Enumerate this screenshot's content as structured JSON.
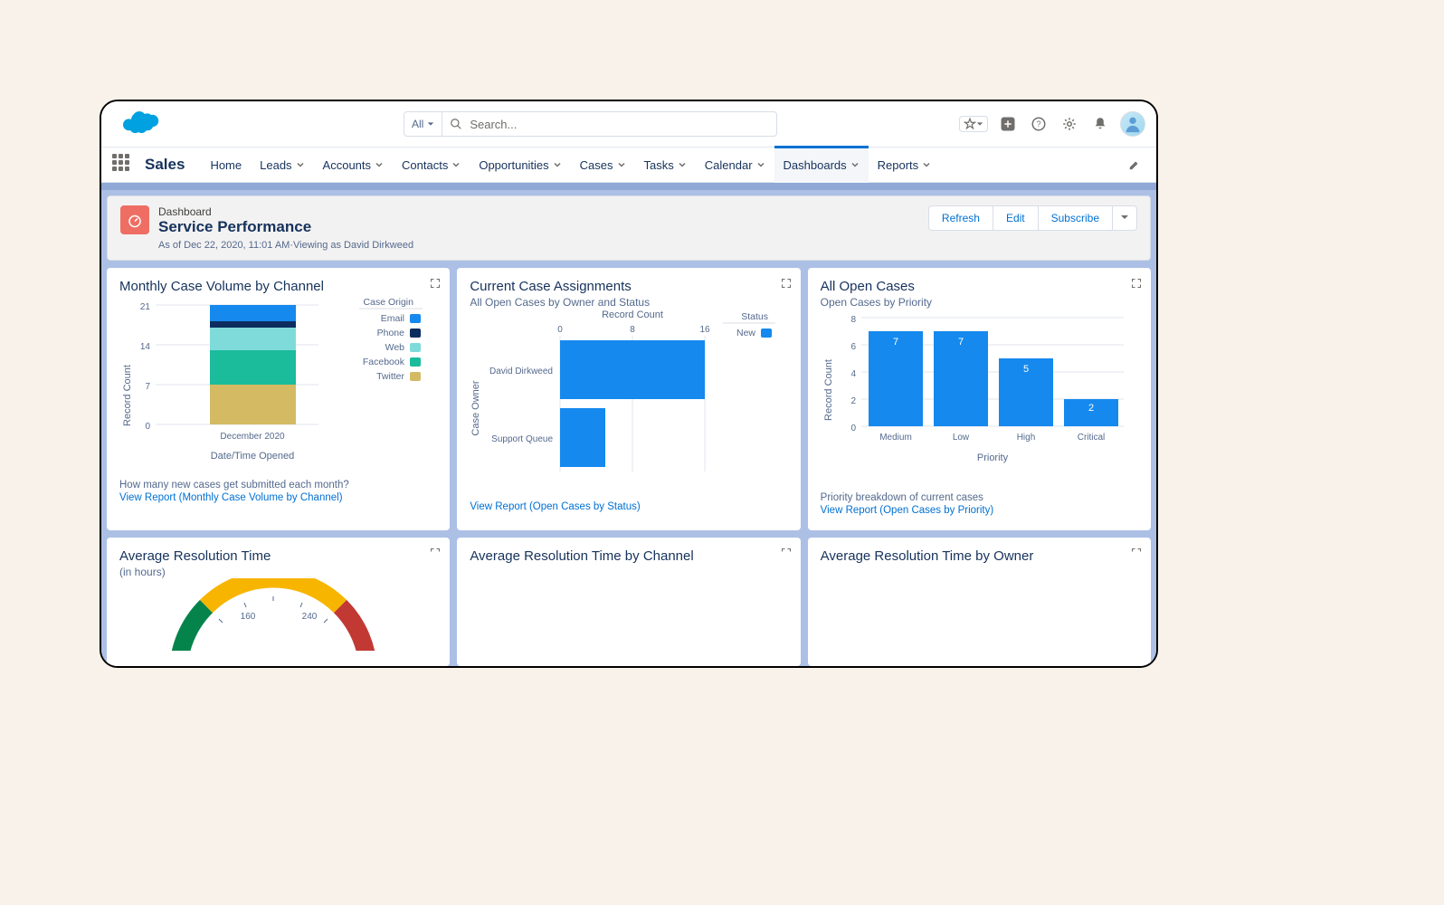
{
  "search": {
    "scope": "All",
    "placeholder": "Search..."
  },
  "app_name": "Sales",
  "nav": [
    "Home",
    "Leads",
    "Accounts",
    "Contacts",
    "Opportunities",
    "Cases",
    "Tasks",
    "Calendar",
    "Dashboards",
    "Reports"
  ],
  "nav_active": "Dashboards",
  "header": {
    "label": "Dashboard",
    "title": "Service Performance",
    "subtitle": "As of Dec 22, 2020, 11:01 AM·Viewing as David Dirkweed",
    "actions": {
      "refresh": "Refresh",
      "edit": "Edit",
      "subscribe": "Subscribe"
    }
  },
  "cards": {
    "monthly": {
      "title": "Monthly Case Volume by Channel",
      "legend_title": "Case Origin",
      "footer": "How many new cases get submitted each month?",
      "link": "View Report (Monthly Case Volume by Channel)",
      "xlabel": "Date/Time Opened",
      "ylabel": "Record Count",
      "cat_label": "December 2020"
    },
    "assign": {
      "title": "Current Case Assignments",
      "subtitle": "All Open Cases by Owner and Status",
      "legend_title": "Status",
      "legend_item": "New",
      "link": "View Report (Open Cases by Status)",
      "xlabel": "Record Count",
      "ylabel": "Case Owner"
    },
    "open": {
      "title": "All Open Cases",
      "subtitle": "Open Cases by Priority",
      "footer": "Priority breakdown of current cases",
      "link": "View Report (Open Cases by Priority)",
      "xlabel": "Priority",
      "ylabel": "Record Count"
    },
    "avg": {
      "title": "Average Resolution Time",
      "subtitle": "(in hours)",
      "t160": "160",
      "t240": "240"
    },
    "avg_ch": {
      "title": "Average Resolution Time by Channel"
    },
    "avg_ow": {
      "title": "Average Resolution Time by Owner"
    }
  },
  "chart_data": [
    {
      "type": "bar",
      "stacked": true,
      "title": "Monthly Case Volume by Channel",
      "categories": [
        "December 2020"
      ],
      "series": [
        {
          "name": "Email",
          "values": [
            2
          ],
          "color": "#1589ee"
        },
        {
          "name": "Phone",
          "values": [
            1
          ],
          "color": "#0d2d5e"
        },
        {
          "name": "Web",
          "values": [
            5
          ],
          "color": "#1abc9c"
        },
        {
          "name": "Facebook",
          "values": [
            6
          ],
          "color": "#7fdbff"
        },
        {
          "name": "Twitter",
          "values": [
            7
          ],
          "color": "#d4bb63"
        }
      ],
      "xlabel": "Date/Time Opened",
      "ylabel": "Record Count",
      "ylim": [
        0,
        21
      ],
      "yticks": [
        0,
        7,
        14,
        21
      ]
    },
    {
      "type": "bar",
      "orientation": "horizontal",
      "title": "Current Case Assignments",
      "categories": [
        "David Dirkweed",
        "Support Queue"
      ],
      "series": [
        {
          "name": "New",
          "values": [
            16,
            5
          ],
          "color": "#1589ee"
        }
      ],
      "xlabel": "Record Count",
      "ylabel": "Case Owner",
      "xlim": [
        0,
        16
      ],
      "xticks": [
        0,
        8,
        16
      ]
    },
    {
      "type": "bar",
      "title": "All Open Cases",
      "categories": [
        "Medium",
        "Low",
        "High",
        "Critical"
      ],
      "values": [
        7,
        7,
        5,
        2
      ],
      "xlabel": "Priority",
      "ylabel": "Record Count",
      "ylim": [
        0,
        8
      ],
      "yticks": [
        0,
        2,
        4,
        6,
        8
      ],
      "color": "#1589ee"
    },
    {
      "type": "gauge",
      "title": "Average Resolution Time",
      "unit": "hours",
      "ticks": [
        160,
        240
      ],
      "segments": [
        {
          "color": "#04844b"
        },
        {
          "color": "#f7b500"
        },
        {
          "color": "#c23934"
        }
      ]
    }
  ]
}
